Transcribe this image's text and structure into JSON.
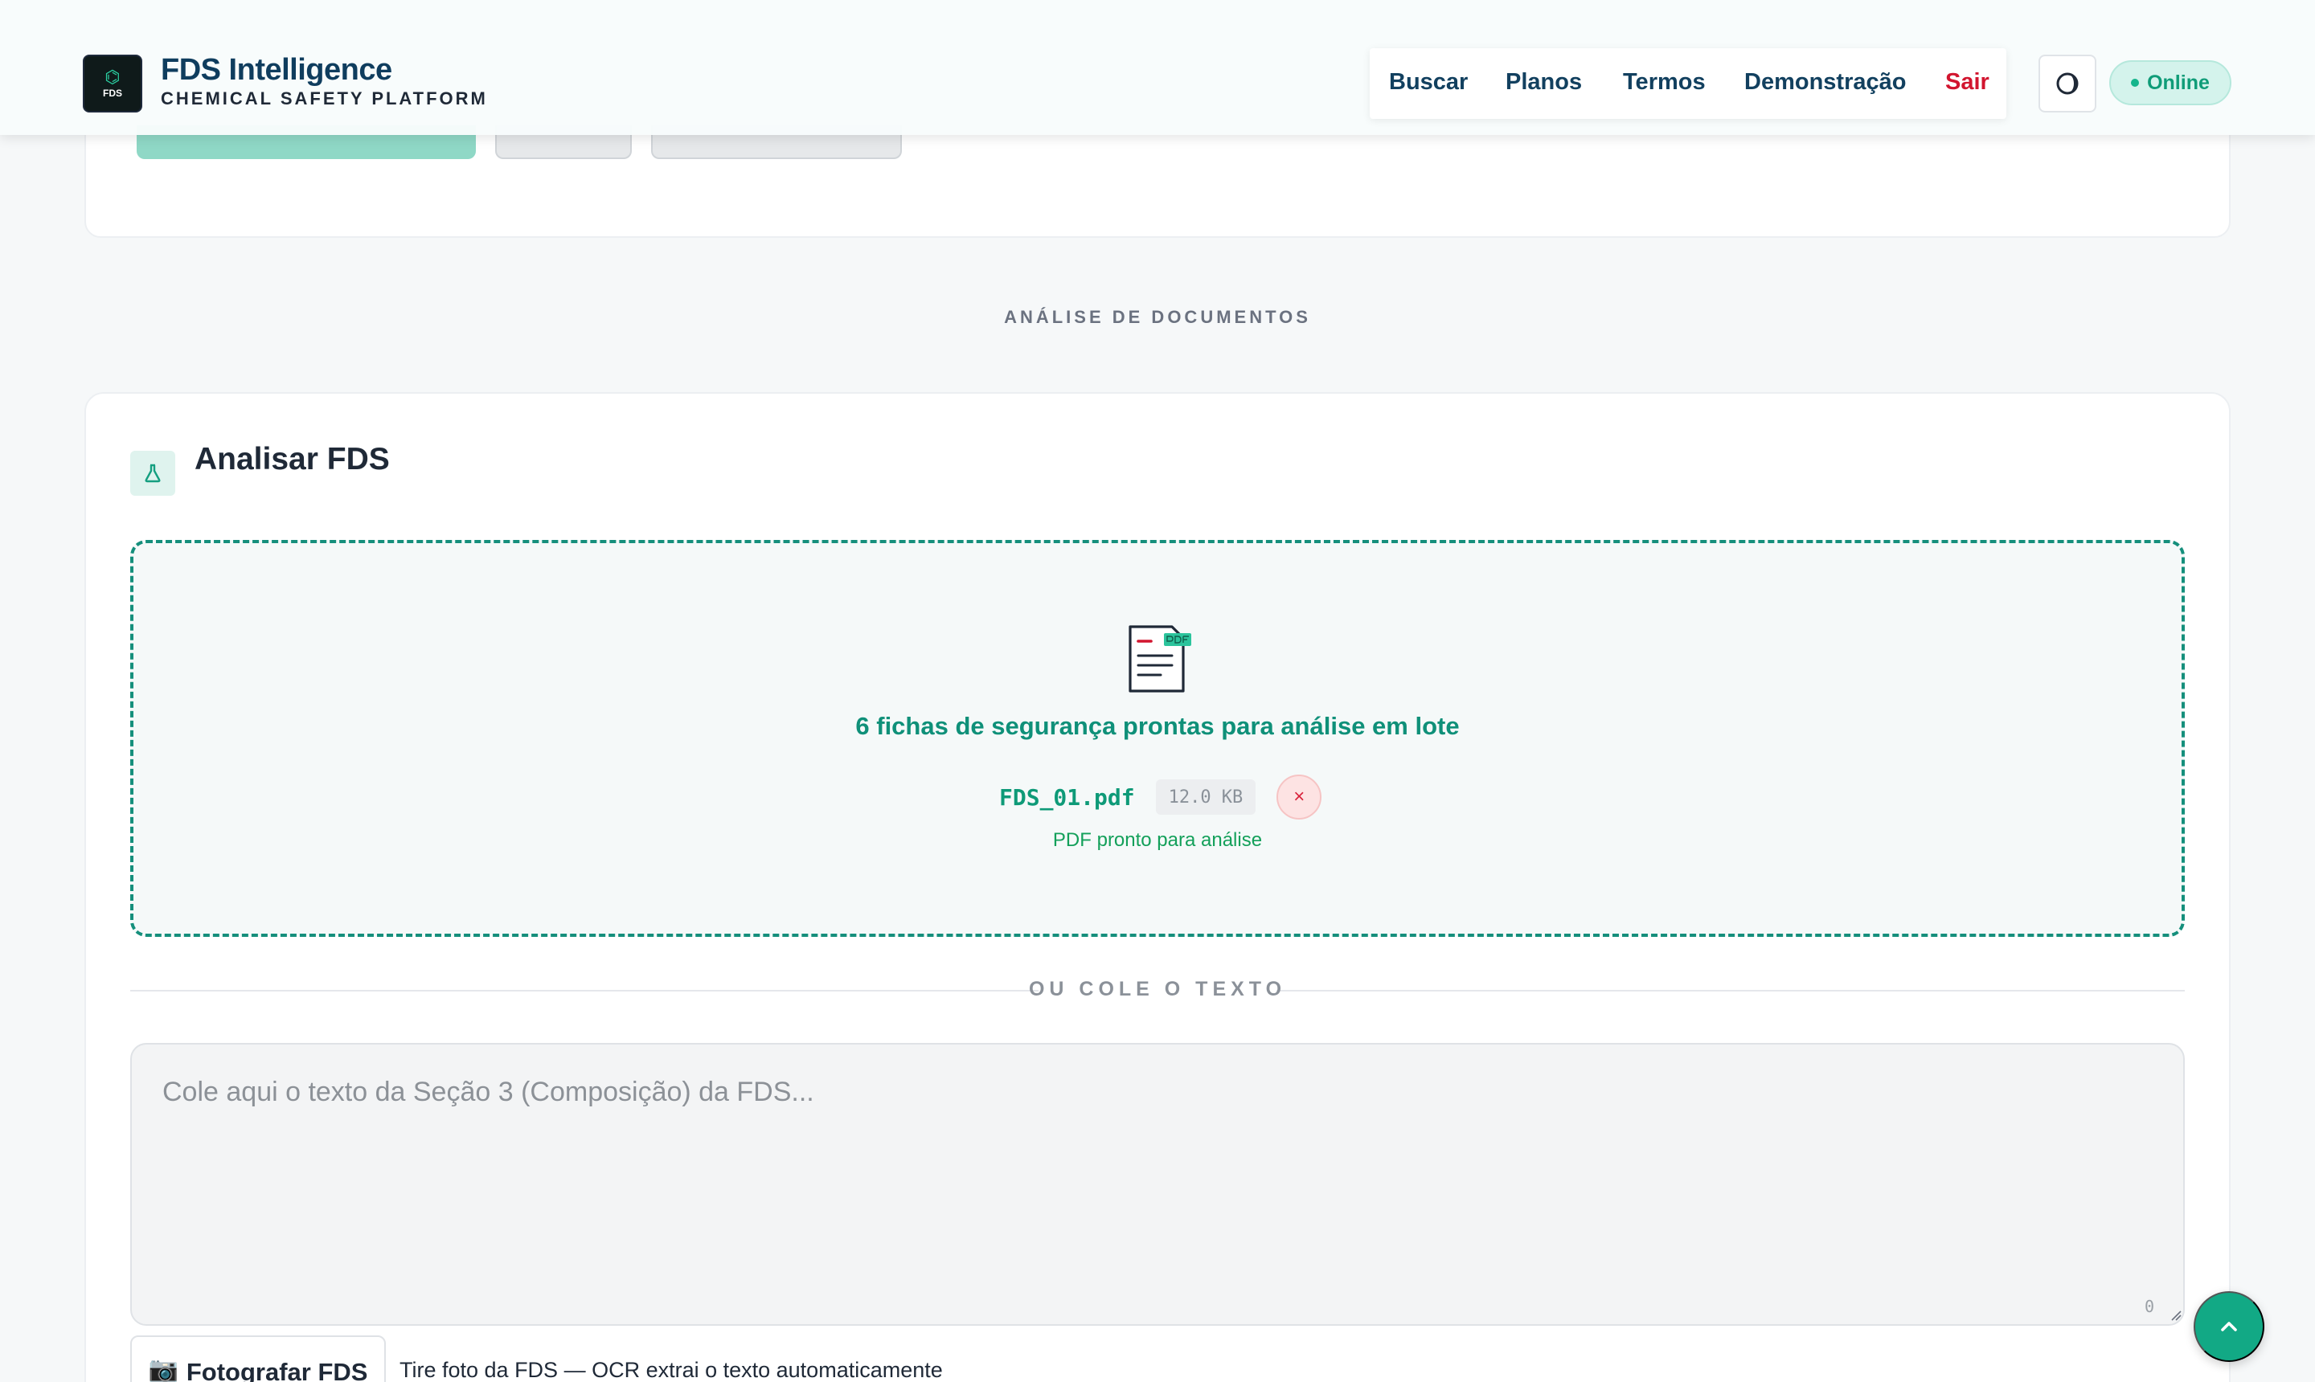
{
  "brand": {
    "logo_text": "FDS",
    "title": "FDS Intelligence",
    "subtitle": "CHEMICAL SAFETY PLATFORM"
  },
  "nav": {
    "items": [
      "Buscar",
      "Planos",
      "Termos",
      "Demonstração"
    ],
    "logout": "Sair"
  },
  "status": {
    "label": "Online",
    "color": "#15b58c"
  },
  "section_label": "ANÁLISE DE DOCUMENTOS",
  "analyze": {
    "title": "Analisar FDS",
    "icon": "flask-icon",
    "dropzone": {
      "title": "6 fichas de segurança prontas para análise em lote",
      "file_name": "FDS_01.pdf",
      "file_size": "12.0 KB",
      "remove_label": "×",
      "file_status": "PDF pronto para análise",
      "icon": "pdf-document-icon"
    },
    "divider": "OU COLE O TEXTO",
    "paste": {
      "placeholder": "Cole aqui o texto da Seção 3 (Composição) da FDS...",
      "char_count": "0"
    },
    "photo": {
      "label": "Fotografar FDS",
      "icon": "camera-icon",
      "hint": "Tire foto da FDS — OCR extrai o texto automaticamente"
    }
  },
  "colors": {
    "accent": "#12a985",
    "brand_navy": "#0f3d5e",
    "logout_red": "#d2152f"
  }
}
